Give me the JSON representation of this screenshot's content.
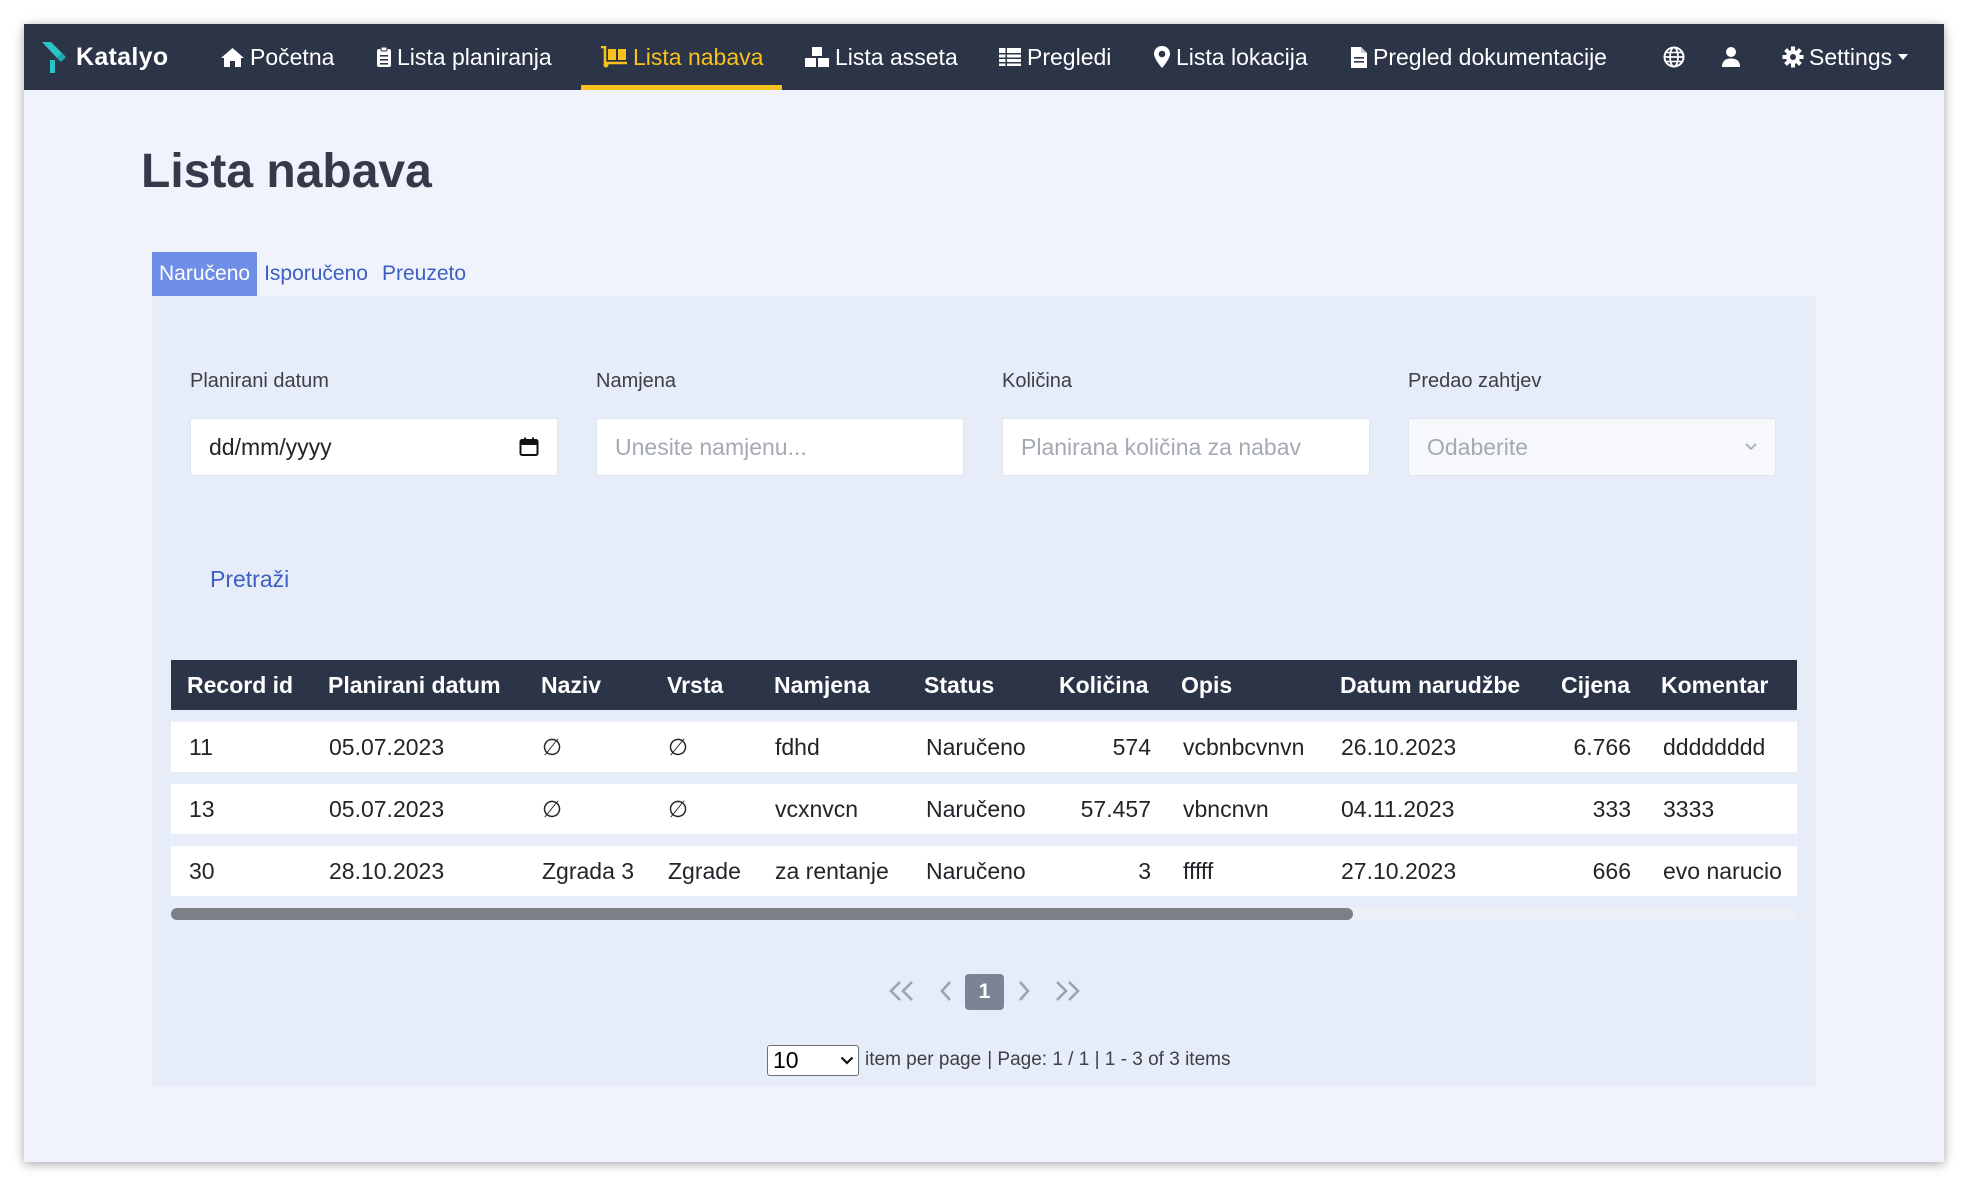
{
  "navbar": {
    "brand": "Katalyo",
    "items": [
      {
        "label": "Početna",
        "icon": "home-icon"
      },
      {
        "label": "Lista planiranja",
        "icon": "clipboard-icon"
      },
      {
        "label": "Lista nabava",
        "icon": "dolly-icon",
        "active": true
      },
      {
        "label": "Lista asseta",
        "icon": "boxes-icon"
      },
      {
        "label": "Pregledi",
        "icon": "table-icon"
      },
      {
        "label": "Lista lokacija",
        "icon": "map-pin-icon"
      },
      {
        "label": "Pregled dokumentacije",
        "icon": "file-icon"
      }
    ],
    "settings": "Settings",
    "colors": {
      "background": "#2c3448",
      "active": "#f7c21b"
    }
  },
  "page": {
    "title": "Lista nabava"
  },
  "tabs": [
    {
      "label": "Naručeno",
      "active": true
    },
    {
      "label": "Isporučeno"
    },
    {
      "label": "Preuzeto"
    }
  ],
  "filters": {
    "planned_date": {
      "label": "Planirani datum",
      "value": "dd/mm/yyyy"
    },
    "purpose": {
      "label": "Namjena",
      "placeholder": "Unesite namjenu..."
    },
    "quantity": {
      "label": "Količina",
      "placeholder": "Planirana količina za nabav"
    },
    "requester": {
      "label": "Predao zahtjev",
      "value": "Odaberite"
    },
    "search_label": "Pretraži"
  },
  "table": {
    "headers": [
      "Record id",
      "Planirani datum",
      "Naziv",
      "Vrsta",
      "Namjena",
      "Status",
      "Količina",
      "Opis",
      "Datum narudžbe",
      "Cijena",
      "Komentar"
    ],
    "rows": [
      [
        "11",
        "05.07.2023",
        "∅",
        "∅",
        "fdhd",
        "Naručeno",
        "574",
        "vcbnbcvnvn",
        "26.10.2023",
        "6.766",
        "dddddddd"
      ],
      [
        "13",
        "05.07.2023",
        "∅",
        "∅",
        "vcxnvcn",
        "Naručeno",
        "57.457",
        "vbncnvn",
        "04.11.2023",
        "333",
        "3333"
      ],
      [
        "30",
        "28.10.2023",
        "Zgrada 3",
        "Zgrade",
        "za rentanje",
        "Naručeno",
        "3",
        "fffff",
        "27.10.2023",
        "666",
        "evo narucio"
      ]
    ]
  },
  "pagination": {
    "current_page": "1",
    "per_page_value": "10",
    "per_page_label": "item per page",
    "summary": "| Page: 1 / 1 | 1 - 3 of 3 items"
  }
}
